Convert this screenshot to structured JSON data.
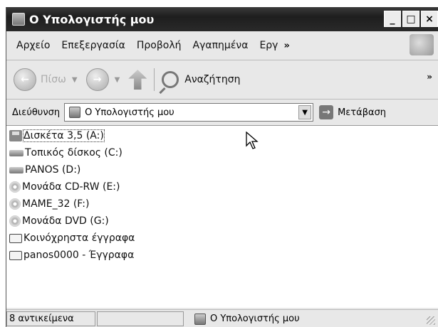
{
  "window": {
    "title": "Ο Υπολογιστής μου",
    "minimize": "_",
    "maximize": "□",
    "close": "×"
  },
  "menu": {
    "items": [
      "Αρχείο",
      "Επεξεργασία",
      "Προβολή",
      "Αγαπημένα",
      "Εργ"
    ],
    "overflow": "»"
  },
  "toolbar": {
    "back_label": "Πίσω",
    "search_label": "Αναζήτηση",
    "overflow": "»"
  },
  "address": {
    "label": "Διεύθυνση",
    "value": "Ο Υπολογιστής μου",
    "go_label": "Μετάβαση"
  },
  "items": [
    {
      "label": "Δισκέτα 3,5 (A:)",
      "icon": "floppy-drive-icon"
    },
    {
      "label": "Τοπικός δίσκος (C:)",
      "icon": "local-disk-icon"
    },
    {
      "label": "PANOS (D:)",
      "icon": "local-disk-icon"
    },
    {
      "label": "Μονάδα CD-RW (E:)",
      "icon": "cd-drive-icon"
    },
    {
      "label": "MAME_32 (F:)",
      "icon": "cd-drive-icon"
    },
    {
      "label": "Μονάδα DVD (G:)",
      "icon": "dvd-drive-icon"
    },
    {
      "label": "Κοινόχρηστα έγγραφα",
      "icon": "folder-icon"
    },
    {
      "label": "panos0000 - Έγγραφα",
      "icon": "folder-icon"
    }
  ],
  "status": {
    "count": "8 αντικείμενα",
    "location": "Ο Υπολογιστής μου"
  }
}
